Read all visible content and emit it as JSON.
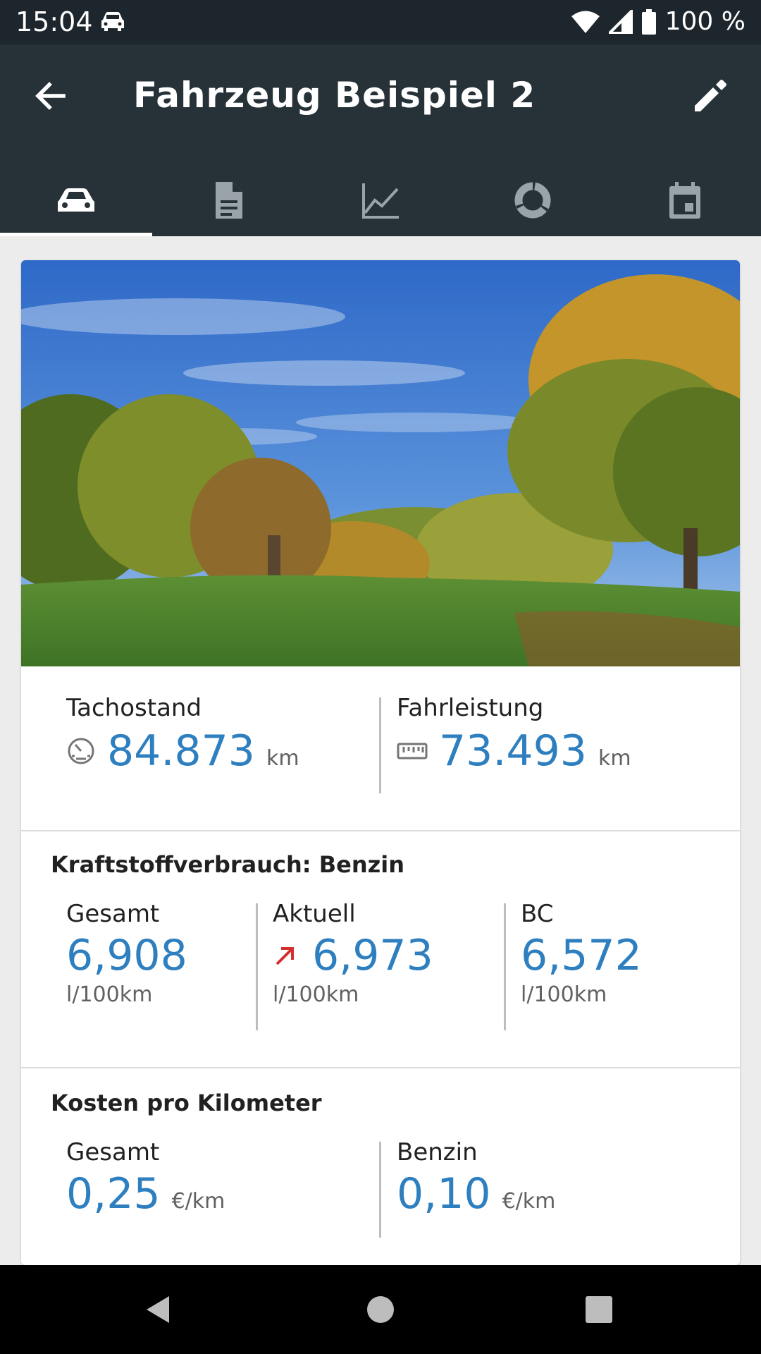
{
  "status_bar": {
    "time": "15:04",
    "battery": "100 %"
  },
  "app_bar": {
    "title": "Fahrzeug Beispiel 2"
  },
  "tabs": [
    {
      "icon": "car-icon",
      "active": true
    },
    {
      "icon": "document-icon",
      "active": false
    },
    {
      "icon": "chart-icon",
      "active": false
    },
    {
      "icon": "service-ring-icon",
      "active": false
    },
    {
      "icon": "calendar-icon",
      "active": false
    }
  ],
  "odometer": {
    "label": "Tachostand",
    "value": "84.873",
    "unit": "km"
  },
  "mileage": {
    "label": "Fahrleistung",
    "value": "73.493",
    "unit": "km"
  },
  "fuel": {
    "title": "Kraftstoffverbrauch: Benzin",
    "total": {
      "label": "Gesamt",
      "value": "6,908",
      "unit": "l/100km"
    },
    "current": {
      "label": "Aktuell",
      "value": "6,973",
      "unit": "l/100km"
    },
    "bc": {
      "label": "BC",
      "value": "6,572",
      "unit": "l/100km"
    }
  },
  "cost": {
    "title": "Kosten pro Kilometer",
    "total": {
      "label": "Gesamt",
      "value": "0,25",
      "unit": "€/km"
    },
    "fuel": {
      "label": "Benzin",
      "value": "0,10",
      "unit": "€/km"
    }
  },
  "colors": {
    "accent": "#2e7fbf",
    "appbar": "#263238",
    "trend_up": "#d32f2f"
  }
}
